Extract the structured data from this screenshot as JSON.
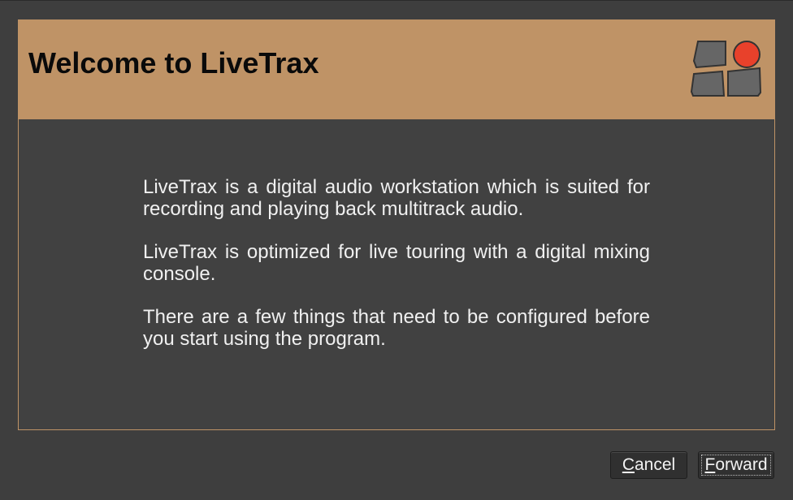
{
  "dialog": {
    "title": "Welcome to LiveTrax",
    "logo_icon": "livetrax-logo-icon",
    "paragraphs": [
      "LiveTrax is a digital audio workstation which is suited for recording and playing back multitrack audio.",
      "LiveTrax is optimized for live touring with a digital mixing console.",
      "There are a few things that need to be configured before you start using the program."
    ]
  },
  "buttons": {
    "cancel": {
      "mnemonic": "C",
      "rest": "ancel"
    },
    "forward": {
      "mnemonic": "F",
      "rest": "orward"
    }
  },
  "colors": {
    "header_bg": "#bf9366",
    "window_bg": "#3e3e3e",
    "logo_gray": "#666666",
    "logo_red": "#e8412b",
    "text": "#f0f0f0"
  }
}
